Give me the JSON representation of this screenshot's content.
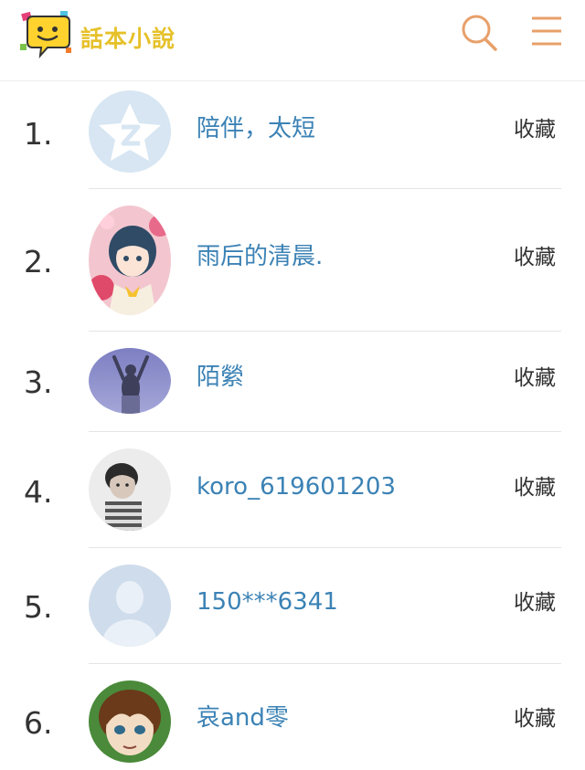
{
  "header": {
    "logo_text": "話本小說",
    "logo_icon": "speech-bubble-face-icon",
    "search_icon": "search-icon",
    "menu_icon": "hamburger-menu-icon",
    "accent_color": "#e8a06a",
    "logo_color": "#e6c12a"
  },
  "list": {
    "items": [
      {
        "rank": "1.",
        "name": "陪伴，太短",
        "action": "收藏",
        "avatar": "qzone-default-avatar"
      },
      {
        "rank": "2.",
        "name": "雨后的清晨.",
        "action": "收藏",
        "avatar": "anime-girl-avatar"
      },
      {
        "rank": "3.",
        "name": "陌縈",
        "action": "收藏",
        "avatar": "person-arms-raised-avatar"
      },
      {
        "rank": "4.",
        "name": "koro_619601203",
        "action": "收藏",
        "avatar": "child-photo-avatar"
      },
      {
        "rank": "5.",
        "name": "150***6341",
        "action": "收藏",
        "avatar": "default-person-avatar"
      },
      {
        "rank": "6.",
        "name": "哀and零",
        "action": "收藏",
        "avatar": "anime-boy-avatar"
      }
    ]
  },
  "colors": {
    "username": "#3b82b5",
    "rank_text": "#333333",
    "divider": "#e4e4e4"
  }
}
